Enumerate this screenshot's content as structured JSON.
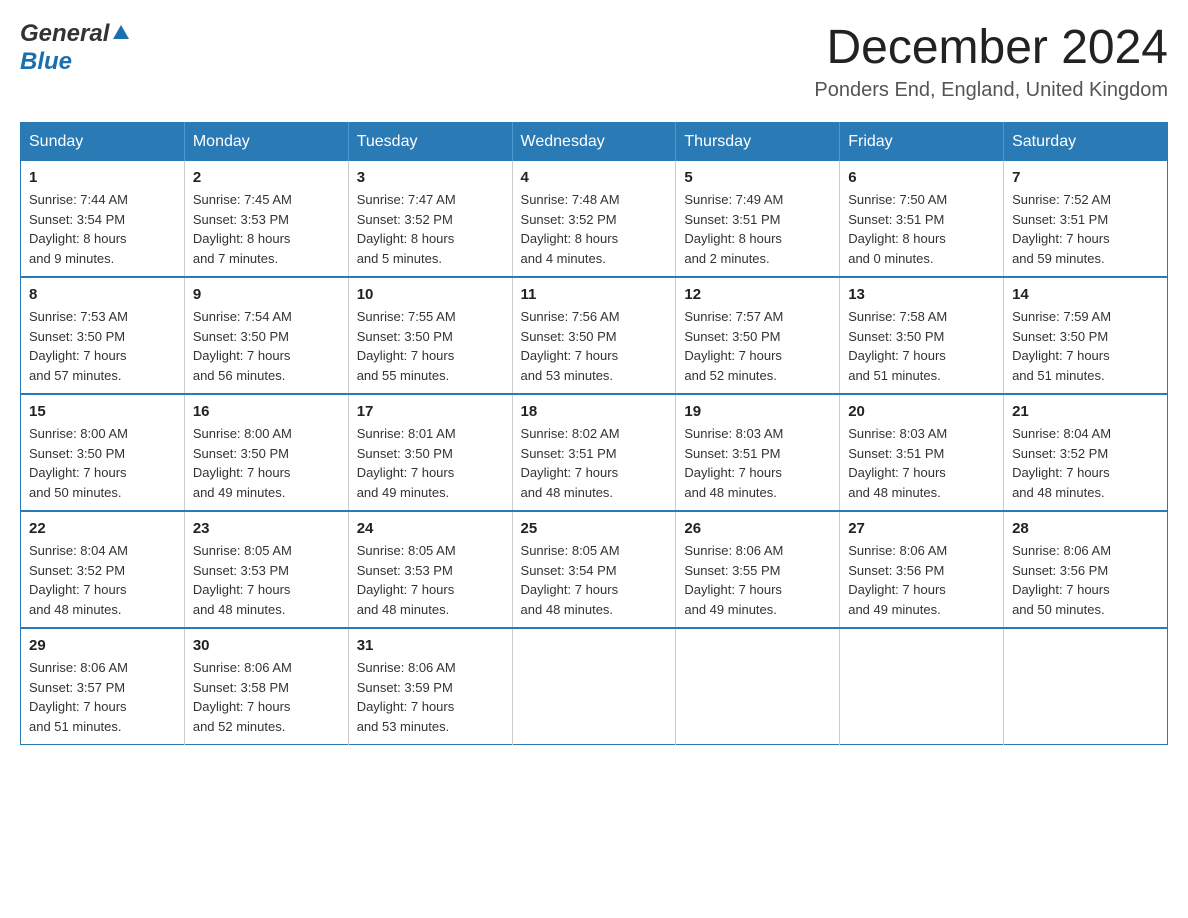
{
  "header": {
    "logo": {
      "general": "General",
      "blue": "Blue"
    },
    "title": "December 2024",
    "subtitle": "Ponders End, England, United Kingdom"
  },
  "calendar": {
    "days": [
      "Sunday",
      "Monday",
      "Tuesday",
      "Wednesday",
      "Thursday",
      "Friday",
      "Saturday"
    ],
    "weeks": [
      [
        {
          "day": "1",
          "sunrise": "7:44 AM",
          "sunset": "3:54 PM",
          "daylight": "8 hours and 9 minutes."
        },
        {
          "day": "2",
          "sunrise": "7:45 AM",
          "sunset": "3:53 PM",
          "daylight": "8 hours and 7 minutes."
        },
        {
          "day": "3",
          "sunrise": "7:47 AM",
          "sunset": "3:52 PM",
          "daylight": "8 hours and 5 minutes."
        },
        {
          "day": "4",
          "sunrise": "7:48 AM",
          "sunset": "3:52 PM",
          "daylight": "8 hours and 4 minutes."
        },
        {
          "day": "5",
          "sunrise": "7:49 AM",
          "sunset": "3:51 PM",
          "daylight": "8 hours and 2 minutes."
        },
        {
          "day": "6",
          "sunrise": "7:50 AM",
          "sunset": "3:51 PM",
          "daylight": "8 hours and 0 minutes."
        },
        {
          "day": "7",
          "sunrise": "7:52 AM",
          "sunset": "3:51 PM",
          "daylight": "7 hours and 59 minutes."
        }
      ],
      [
        {
          "day": "8",
          "sunrise": "7:53 AM",
          "sunset": "3:50 PM",
          "daylight": "7 hours and 57 minutes."
        },
        {
          "day": "9",
          "sunrise": "7:54 AM",
          "sunset": "3:50 PM",
          "daylight": "7 hours and 56 minutes."
        },
        {
          "day": "10",
          "sunrise": "7:55 AM",
          "sunset": "3:50 PM",
          "daylight": "7 hours and 55 minutes."
        },
        {
          "day": "11",
          "sunrise": "7:56 AM",
          "sunset": "3:50 PM",
          "daylight": "7 hours and 53 minutes."
        },
        {
          "day": "12",
          "sunrise": "7:57 AM",
          "sunset": "3:50 PM",
          "daylight": "7 hours and 52 minutes."
        },
        {
          "day": "13",
          "sunrise": "7:58 AM",
          "sunset": "3:50 PM",
          "daylight": "7 hours and 51 minutes."
        },
        {
          "day": "14",
          "sunrise": "7:59 AM",
          "sunset": "3:50 PM",
          "daylight": "7 hours and 51 minutes."
        }
      ],
      [
        {
          "day": "15",
          "sunrise": "8:00 AM",
          "sunset": "3:50 PM",
          "daylight": "7 hours and 50 minutes."
        },
        {
          "day": "16",
          "sunrise": "8:00 AM",
          "sunset": "3:50 PM",
          "daylight": "7 hours and 49 minutes."
        },
        {
          "day": "17",
          "sunrise": "8:01 AM",
          "sunset": "3:50 PM",
          "daylight": "7 hours and 49 minutes."
        },
        {
          "day": "18",
          "sunrise": "8:02 AM",
          "sunset": "3:51 PM",
          "daylight": "7 hours and 48 minutes."
        },
        {
          "day": "19",
          "sunrise": "8:03 AM",
          "sunset": "3:51 PM",
          "daylight": "7 hours and 48 minutes."
        },
        {
          "day": "20",
          "sunrise": "8:03 AM",
          "sunset": "3:51 PM",
          "daylight": "7 hours and 48 minutes."
        },
        {
          "day": "21",
          "sunrise": "8:04 AM",
          "sunset": "3:52 PM",
          "daylight": "7 hours and 48 minutes."
        }
      ],
      [
        {
          "day": "22",
          "sunrise": "8:04 AM",
          "sunset": "3:52 PM",
          "daylight": "7 hours and 48 minutes."
        },
        {
          "day": "23",
          "sunrise": "8:05 AM",
          "sunset": "3:53 PM",
          "daylight": "7 hours and 48 minutes."
        },
        {
          "day": "24",
          "sunrise": "8:05 AM",
          "sunset": "3:53 PM",
          "daylight": "7 hours and 48 minutes."
        },
        {
          "day": "25",
          "sunrise": "8:05 AM",
          "sunset": "3:54 PM",
          "daylight": "7 hours and 48 minutes."
        },
        {
          "day": "26",
          "sunrise": "8:06 AM",
          "sunset": "3:55 PM",
          "daylight": "7 hours and 49 minutes."
        },
        {
          "day": "27",
          "sunrise": "8:06 AM",
          "sunset": "3:56 PM",
          "daylight": "7 hours and 49 minutes."
        },
        {
          "day": "28",
          "sunrise": "8:06 AM",
          "sunset": "3:56 PM",
          "daylight": "7 hours and 50 minutes."
        }
      ],
      [
        {
          "day": "29",
          "sunrise": "8:06 AM",
          "sunset": "3:57 PM",
          "daylight": "7 hours and 51 minutes."
        },
        {
          "day": "30",
          "sunrise": "8:06 AM",
          "sunset": "3:58 PM",
          "daylight": "7 hours and 52 minutes."
        },
        {
          "day": "31",
          "sunrise": "8:06 AM",
          "sunset": "3:59 PM",
          "daylight": "7 hours and 53 minutes."
        },
        null,
        null,
        null,
        null
      ]
    ],
    "labels": {
      "sunrise": "Sunrise:",
      "sunset": "Sunset:",
      "daylight": "Daylight:"
    }
  }
}
